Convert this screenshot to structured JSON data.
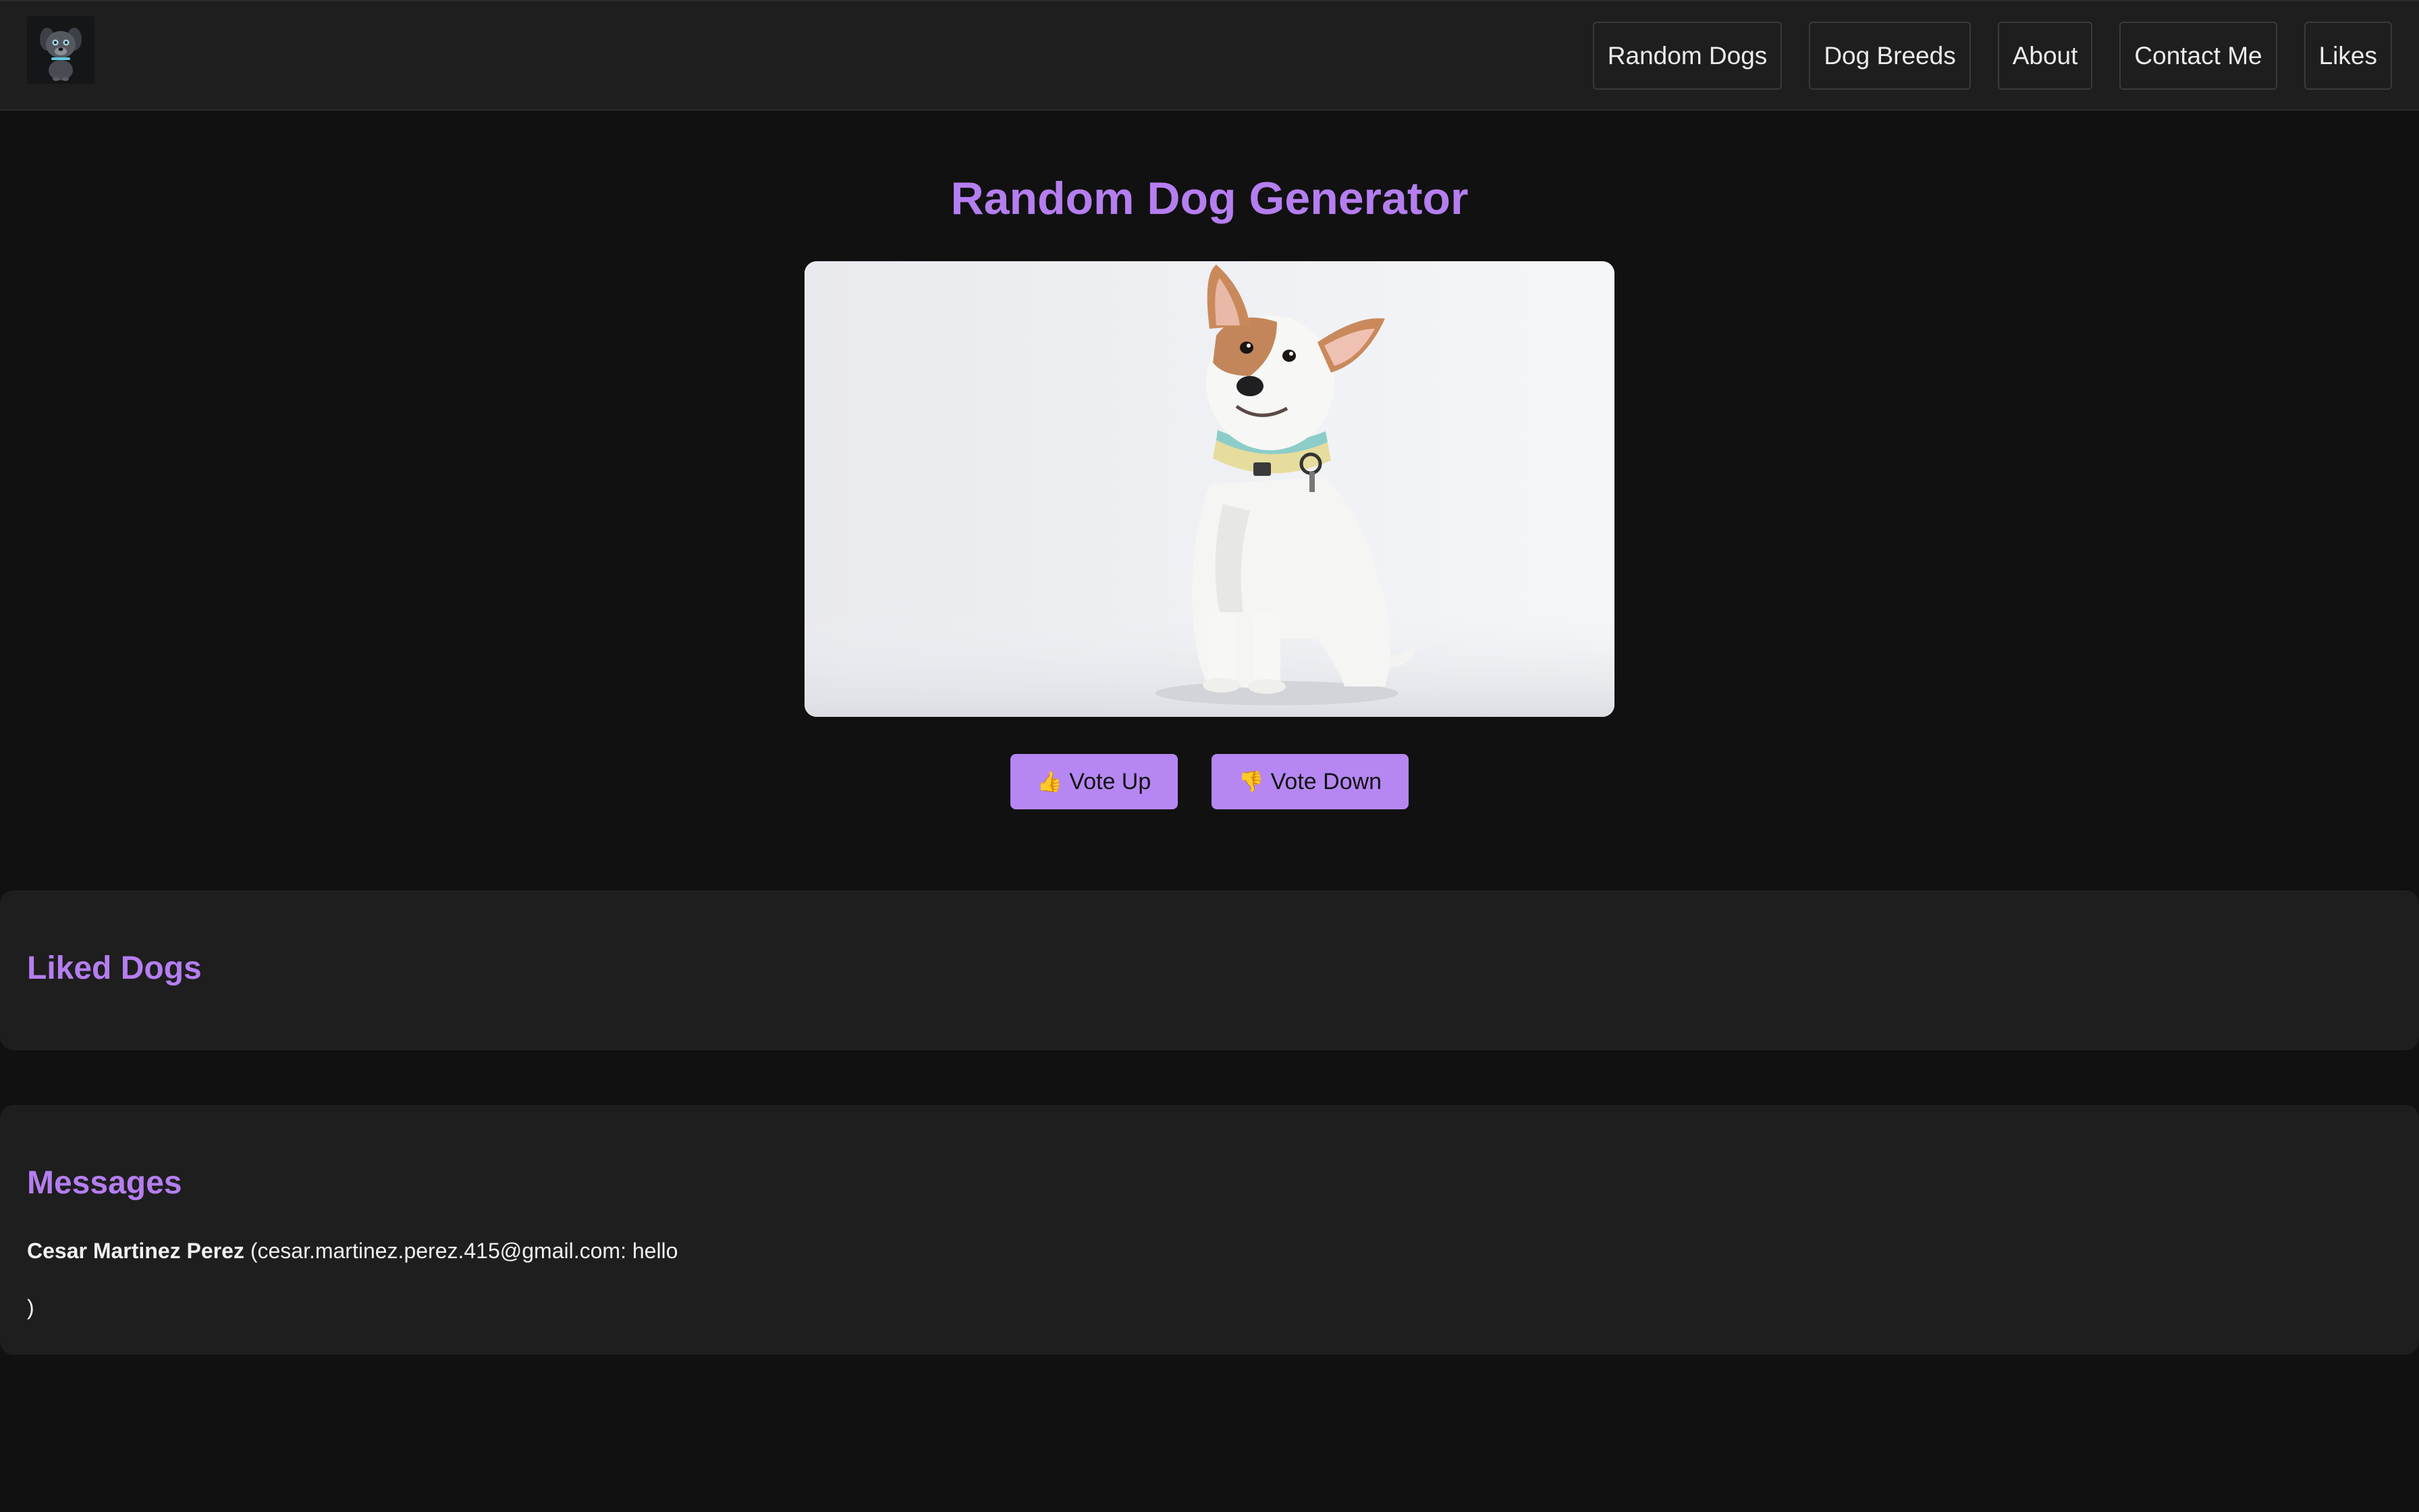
{
  "nav": {
    "links": [
      {
        "label": "Random Dogs"
      },
      {
        "label": "Dog Breeds"
      },
      {
        "label": "About"
      },
      {
        "label": "Contact Me"
      },
      {
        "label": "Likes"
      }
    ]
  },
  "main": {
    "title": "Random Dog Generator",
    "vote_up": {
      "icon": "thumbs-up-icon",
      "glyph": "👍",
      "label": "Vote Up"
    },
    "vote_down": {
      "icon": "thumbs-down-icon",
      "glyph": "👎",
      "label": "Vote Down"
    }
  },
  "liked": {
    "heading": "Liked Dogs"
  },
  "messages": {
    "heading": "Messages",
    "items": [
      {
        "name": "Cesar Martinez Perez",
        "detail": "(cesar.martinez.perez.415@gmail.com: hello",
        "tail": ")"
      }
    ]
  },
  "colors": {
    "accent": "#b57ef0",
    "button_bg": "#b687f3",
    "page_bg": "#111111",
    "panel_bg": "#1e1e1e"
  }
}
